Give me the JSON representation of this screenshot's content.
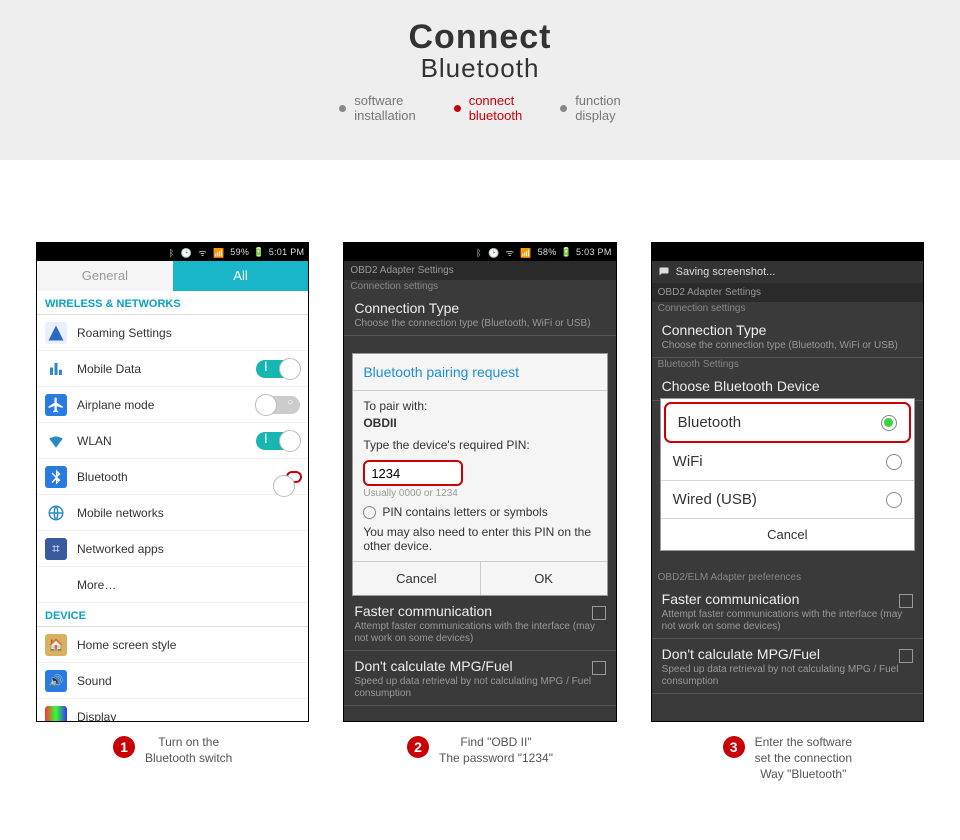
{
  "hero": {
    "title": "Connect",
    "subtitle": "Bluetooth"
  },
  "tabs": [
    {
      "l1": "software",
      "l2": "installation"
    },
    {
      "l1": "connect",
      "l2": "bluetooth"
    },
    {
      "l1": "function",
      "l2": "display"
    }
  ],
  "status": {
    "p1": {
      "pct": "59%",
      "time": "5:01 PM"
    },
    "p2": {
      "pct": "58%",
      "time": "5:03 PM"
    },
    "p3_saving": "Saving screenshot..."
  },
  "p1": {
    "tab_general": "General",
    "tab_all": "All",
    "sec_wn": "WIRELESS & NETWORKS",
    "items": [
      {
        "label": "Roaming Settings"
      },
      {
        "label": "Mobile Data"
      },
      {
        "label": "Airplane mode"
      },
      {
        "label": "WLAN"
      },
      {
        "label": "Bluetooth"
      },
      {
        "label": "Mobile networks"
      },
      {
        "label": "Networked apps"
      },
      {
        "label": "More…"
      }
    ],
    "sec_dev": "DEVICE",
    "dev": [
      {
        "label": "Home screen style"
      },
      {
        "label": "Sound"
      },
      {
        "label": "Display"
      }
    ]
  },
  "obd": {
    "header": "OBD2 Adapter Settings",
    "sub_conn": "Connection settings",
    "conn_type": "Connection Type",
    "conn_desc": "Choose the connection type (Bluetooth, WiFi or USB)",
    "bt_set": "Bluetooth Settings",
    "choose_bt": "Choose Bluetooth Device",
    "obd_pref": "OBD2/ELM Adapter preferences",
    "faster_t": "Faster communication",
    "faster_d": "Attempt faster communications with the interface (may not work on some devices)",
    "mpg_t": "Don't calculate MPG/Fuel",
    "mpg_d": "Speed up data retrieval by not calculating MPG / Fuel consumption"
  },
  "dialog": {
    "title": "Bluetooth pairing request",
    "pair_lbl": "To pair with:",
    "pair_dev": "OBDII",
    "pin_prompt": "Type the device's required PIN:",
    "pin": "1234",
    "hint": "Usually 0000 or 1234",
    "chk": "PIN contains letters or symbols",
    "also": "You may also need to enter this PIN on the other device.",
    "cancel": "Cancel",
    "ok": "OK"
  },
  "ctype": {
    "opts": [
      "Bluetooth",
      "WiFi",
      "Wired (USB)"
    ],
    "cancel": "Cancel"
  },
  "caps": [
    {
      "n": "1",
      "l1": "Turn on the",
      "l2": "Bluetooth switch",
      "l3": ""
    },
    {
      "n": "2",
      "l1": "Find  \"OBD II\"",
      "l2": "The password \"1234\"",
      "l3": ""
    },
    {
      "n": "3",
      "l1": "Enter the software",
      "l2": "set the connection",
      "l3": "Way \"Bluetooth\""
    }
  ]
}
